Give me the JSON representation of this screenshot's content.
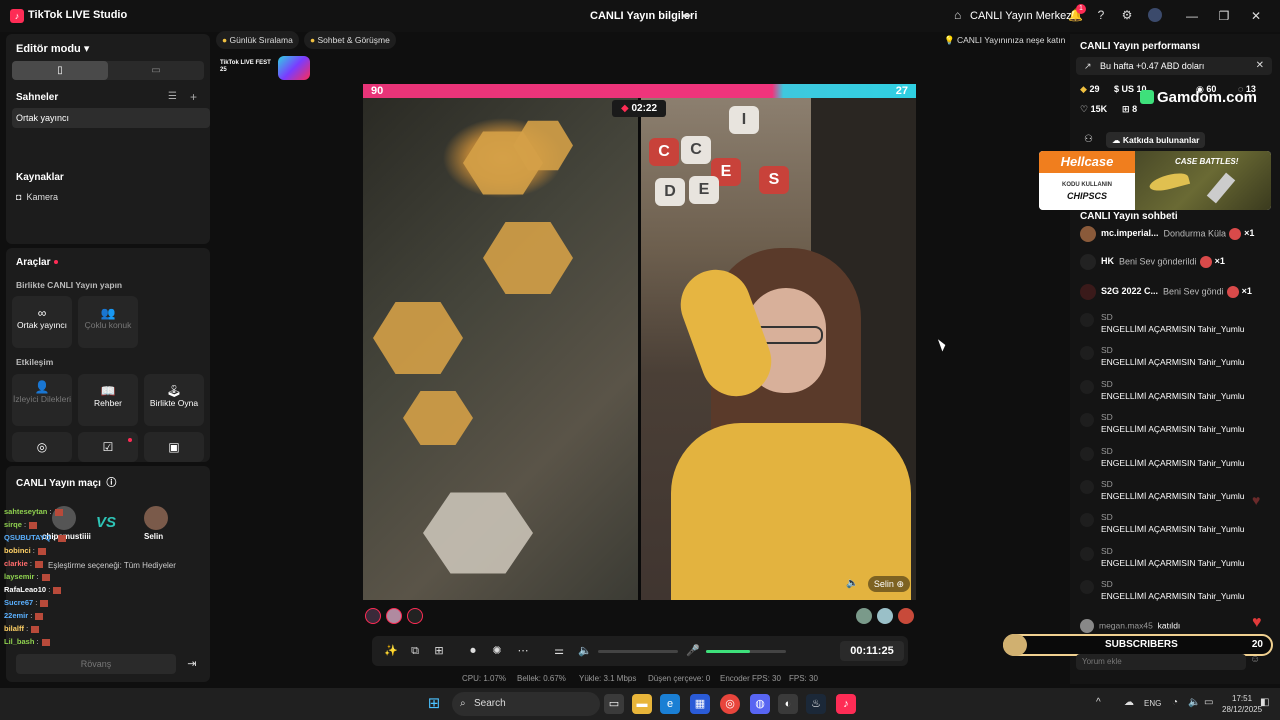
{
  "titlebar": {
    "app_name": "TikTok LIVE Studio",
    "live_info": "CANLI Yayın bilgileri",
    "live_center": "CANLI Yayın Merkezi",
    "notifications": "1"
  },
  "editor": {
    "title": "Editör modu",
    "scenes_title": "Sahneler",
    "scene_item": "Ortak yayıncı",
    "sources_title": "Kaynaklar",
    "source_item": "Kamera"
  },
  "tools": {
    "title": "Araçlar",
    "live_together": "Birlikte CANLI Yayın yapın",
    "co_host": "Ortak yayıncı",
    "multi_guest": "Çoklu konuk",
    "interaction": "Etkileşim",
    "viewer_wishes": "İzleyici Dilekleri",
    "guide": "Rehber",
    "play_together": "Birlikte Oyna"
  },
  "match": {
    "title": "CANLI Yayın maçı",
    "player1": "chipsmustiiii",
    "player2": "Selin",
    "vs": "VS",
    "rematch": "Rövanş",
    "pairing": "Eşleştirme seçeneği: Tüm Hediyeler"
  },
  "left_chat": [
    {
      "name": "sahteseytan",
      "text": ":",
      "color": "#8fd14f"
    },
    {
      "name": "sirqe",
      "text": ":",
      "color": "#8fd14f"
    },
    {
      "name": "QSUBUTAYQ",
      "text": ":",
      "color": "#5ab0ff"
    },
    {
      "name": "bobinci",
      "text": ":",
      "color": "#ffd166"
    },
    {
      "name": "clarkie",
      "text": ":",
      "color": "#ff6b6b"
    },
    {
      "name": "laysemir",
      "text": ":",
      "color": "#8fd14f"
    },
    {
      "name": "RafaLeao10",
      "text": ":",
      "color": "#ffffff"
    },
    {
      "name": "Sucre67",
      "text": ":",
      "color": "#5ab0ff"
    },
    {
      "name": "22emir",
      "text": ":",
      "color": "#5ab0ff"
    },
    {
      "name": "bilalff",
      "text": ":",
      "color": "#ffd166"
    },
    {
      "name": "Lil_bash",
      "text": ":",
      "color": "#8fd14f"
    }
  ],
  "pills": {
    "daily_rank": "Günlük Sıralama",
    "chat_meet": "Sohbet & Görüşme",
    "live_tip": "CANLI Yayınınıza neşe katın",
    "fest": "TikTok LIVE FEST 25"
  },
  "battle": {
    "score_left": "90",
    "score_right": "27",
    "timer": "02:22",
    "guest_name": "Selin",
    "tiles": [
      "C",
      "C",
      "E",
      "S",
      "I",
      "E",
      "D"
    ]
  },
  "controls": {
    "duration": "00:11:25",
    "mic_level": 0.55
  },
  "stats": {
    "cpu": "CPU:  1.07%",
    "memory": "Bellek:  0.67%",
    "upload": "Yükle:  3.1 Mbps",
    "dropped": "Düşen çerçeve:  0",
    "encoder_fps": "Encoder FPS:  30",
    "fps": "FPS:  30"
  },
  "right": {
    "perf_title": "CANLI Yayın performansı",
    "week": "Bu hafta +0.47 ABD doları",
    "coins": "29",
    "usd": "US 10",
    "viewers": "60",
    "likes_small": "13",
    "likes": "15K",
    "gifters": "8",
    "gamdom": "Gamdom.com",
    "contributors": "Katkıda bulunanlar",
    "hellcase_brand": "Hellcase",
    "hellcase_code_label": "KODU KULLANIN",
    "hellcase_code": "CHIPSCS",
    "hellcase_battles": "CASE BATTLES!",
    "chat_title": "CANLI Yayın sohbeti",
    "gifts": [
      {
        "name": "mc.imperial...",
        "text": "Dondurma Küla",
        "count": "×1"
      },
      {
        "name": "HK",
        "text": "Beni Sev gönderildi",
        "count": "×1"
      },
      {
        "name": "S2G 2022 C...",
        "text": "Beni Sev göndi",
        "count": "×1"
      }
    ],
    "messages": [
      {
        "name": "SD",
        "text": "ENGELLİMİ AÇARMISIN Tahir_Yumlu"
      },
      {
        "name": "SD",
        "text": "ENGELLİMİ AÇARMISIN Tahir_Yumlu"
      },
      {
        "name": "SD",
        "text": "ENGELLİMİ AÇARMISIN Tahir_Yumlu"
      },
      {
        "name": "SD",
        "text": "ENGELLİMİ AÇARMISIN Tahir_Yumlu"
      },
      {
        "name": "SD",
        "text": "ENGELLİMİ AÇARMISIN Tahir_Yumlu"
      },
      {
        "name": "SD",
        "text": "ENGELLİMİ AÇARMISIN Tahir_Yumlu"
      },
      {
        "name": "SD",
        "text": "ENGELLİMİ AÇARMISIN Tahir_Yumlu"
      },
      {
        "name": "SD",
        "text": "ENGELLİMİ AÇARMISIN Tahir_Yumlu"
      },
      {
        "name": "SD",
        "text": "ENGELLİMİ AÇARMISIN Tahir_Yumlu"
      }
    ],
    "joined_name": "megan.max45",
    "joined_text": "katıldı",
    "subscribers_label": "SUBSCRIBERS",
    "subscribers_count": "20",
    "comment_placeholder": "Yorum ekle"
  },
  "taskbar": {
    "search": "Search",
    "lang": "ENG",
    "time": "17:51",
    "date": "28/12/2025"
  }
}
